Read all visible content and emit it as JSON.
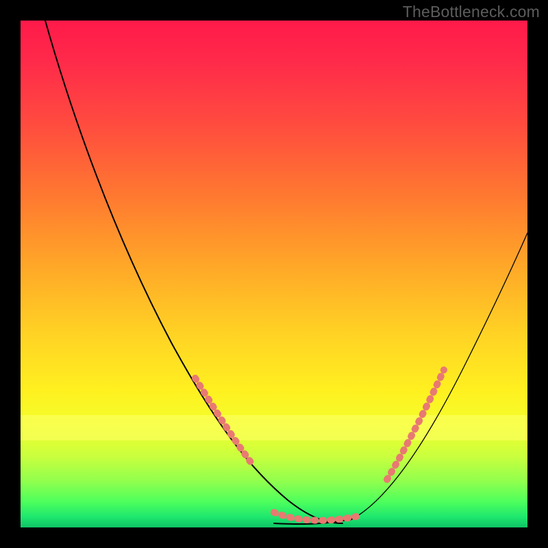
{
  "watermark": "TheBottleneck.com",
  "colors": {
    "background": "#000000",
    "watermark": "#5d5d5d",
    "dot": "#e87a71",
    "curve": "#000000",
    "gradient_stops": [
      "#ff1a4a",
      "#ff2a4a",
      "#ff4a3f",
      "#ff7a30",
      "#ffa628",
      "#ffd324",
      "#fff020",
      "#f3ff2c",
      "#c9ff3e",
      "#8fff4e",
      "#4cff5d",
      "#1de66e",
      "#0fc466"
    ],
    "yellow_band": "#fbff62"
  },
  "chart_data": {
    "type": "line",
    "title": "",
    "xlabel": "",
    "ylabel": "",
    "x_range": [
      0,
      100
    ],
    "y_range": [
      0,
      100
    ],
    "grid": false,
    "legend": "none",
    "note": "Axes have no visible tick labels; y represents bottleneck percentage (red high, green low). x appears to span a performance/utilization axis. Values below are read off the curve shape in percent of plot width/height (0,0 bottom-left); estimates.",
    "series": [
      {
        "name": "bottleneck-curve",
        "x": [
          5,
          10,
          15,
          20,
          25,
          30,
          35,
          40,
          45,
          50,
          55,
          60,
          65,
          70,
          75,
          80,
          85,
          90,
          95,
          100
        ],
        "y": [
          100,
          90,
          78,
          66,
          54,
          42,
          32,
          22,
          14,
          7,
          3,
          1,
          1,
          3,
          8,
          16,
          26,
          37,
          48,
          58
        ]
      }
    ],
    "highlighted_segments": [
      {
        "name": "left-shoulder-dots",
        "x": [
          35,
          37,
          39,
          41,
          43,
          45
        ],
        "y": [
          32,
          28,
          24,
          20,
          17,
          14
        ]
      },
      {
        "name": "valley-floor-dots",
        "x": [
          50,
          53,
          56,
          58,
          60,
          62,
          65,
          68
        ],
        "y": [
          7,
          4,
          2,
          1,
          1,
          1,
          1,
          3
        ]
      },
      {
        "name": "right-shoulder-dots",
        "x": [
          72,
          74,
          76,
          78,
          80,
          82
        ],
        "y": [
          9,
          13,
          18,
          22,
          26,
          31
        ]
      }
    ],
    "yellow_band_y": [
      17,
      22
    ]
  }
}
